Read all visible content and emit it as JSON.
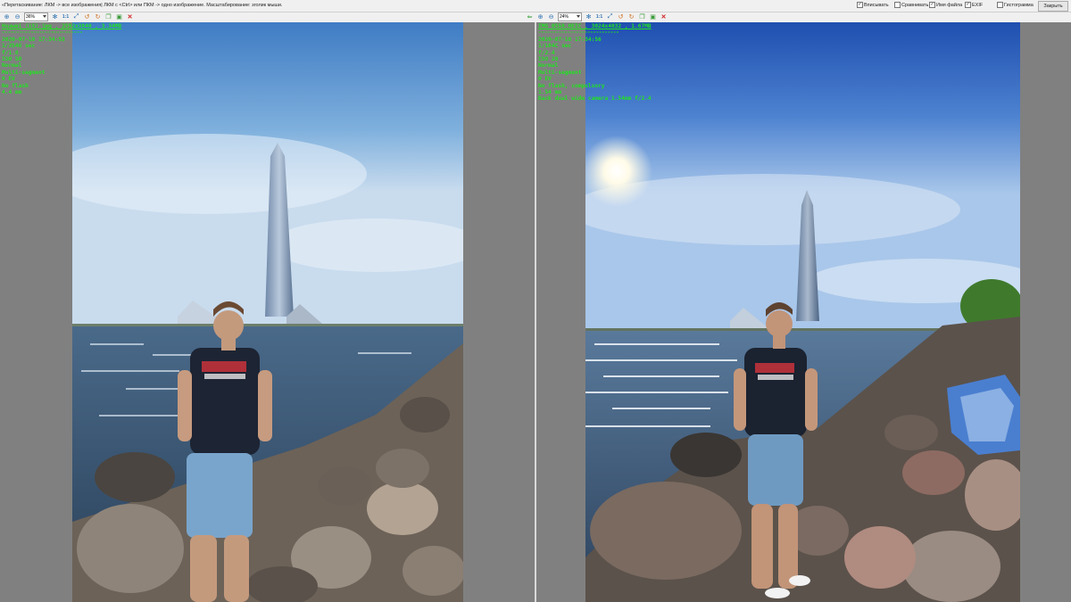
{
  "topbar": {
    "hint": "«Перетаскивание: ЛКМ -> все изображения| ЛКМ с <Ctrl> или ПКМ -> одно изображение. Масштабирование: зголик мыши.",
    "checkboxes": [
      {
        "label": "Вписывать",
        "checked": true
      },
      {
        "label": "Сравнивать",
        "checked": false
      },
      {
        "label": "Имя файла",
        "checked": true
      },
      {
        "label": "EXIF",
        "checked": true
      },
      {
        "label": "Гистограмма",
        "checked": false
      }
    ],
    "close_label": "Закрыть"
  },
  "left_pane": {
    "zoom": "36%",
    "one_to_one": "1:1",
    "file_title": "Huawei (15).jpg , 2592x3840 , 3.34MB",
    "separator": "----------------------------",
    "exif_lines": [
      "2020-07-18 17:34:53",
      "1/3546 sec",
      "f/1.8",
      "ISO 50",
      "Normal",
      "Multi-segment",
      "0 EV",
      "No flash",
      "4.4 mm"
    ]
  },
  "right_pane": {
    "zoom": "24%",
    "one_to_one": "1:1",
    "file_title": "IMG_0558.HEIC , 3024x4032 , 1.67MB",
    "separator": "----------------------------",
    "exif_lines": [
      "2020-07-18 17:34:56",
      "1/104C sec",
      "f/2.4",
      "ISO 20",
      "Normal",
      "Multi-segment",
      "0 EV",
      "No flash, compulsory",
      "1.54 mm",
      "Back dual wide camera 1.54mm f/2.4"
    ]
  },
  "icons": {
    "zoom_in": "zoom-in-icon",
    "zoom_out": "zoom-out-icon",
    "fit": "fit-icon",
    "rotate_left": "rotate-left-icon",
    "rotate_right": "rotate-right-icon",
    "save": "save-icon",
    "delete": "delete-icon"
  },
  "colors": {
    "exif_text": "#22e022",
    "pane_bg": "#808080"
  }
}
